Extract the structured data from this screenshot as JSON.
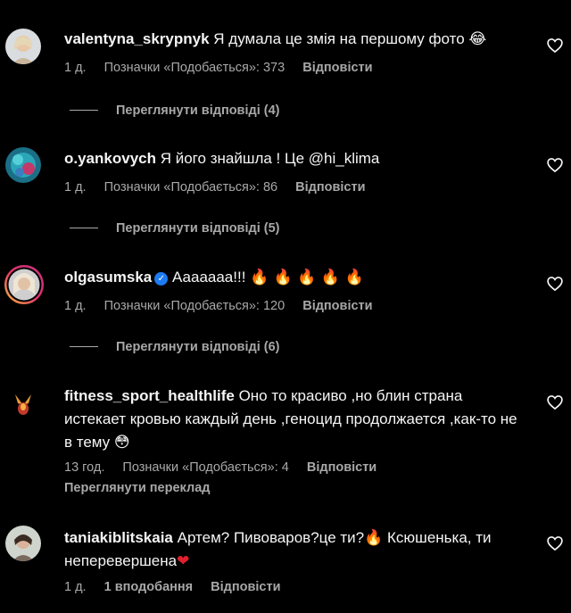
{
  "comments": [
    {
      "username": "valentyna_skrypnyk",
      "text": "Я думала це змія на першому фото",
      "emoji": "😂",
      "time": "1 д.",
      "likes": "Позначки «Подобається»: 373",
      "reply": "Відповісти",
      "view_replies": "Переглянути відповіді (4)"
    },
    {
      "username": "o.yankovych",
      "text": "Я його знайшла ! Це @hi_klima",
      "time": "1 д.",
      "likes": "Позначки «Подобається»: 86",
      "reply": "Відповісти",
      "view_replies": "Переглянути відповіді (5)"
    },
    {
      "username": "olgasumska",
      "verified": "✓",
      "text": "Ааааааа!!!",
      "emoji": "🔥 🔥 🔥 🔥 🔥",
      "time": "1 д.",
      "likes": "Позначки «Подобається»: 120",
      "reply": "Відповісти",
      "view_replies": "Переглянути відповіді (6)"
    },
    {
      "username": "fitness_sport_healthlife",
      "text": "Оно то красиво ,но блин страна истекает кровью каждый день ,геноцид продолжается ,как-то не в тему",
      "emoji": "😳",
      "time": "13 год.",
      "likes": "Позначки «Подобається»: 4",
      "reply": "Відповісти",
      "translate": "Переглянути переклад"
    },
    {
      "username": "taniakiblitskaia",
      "text": "Артем? Пивоваров?це ти?",
      "emoji": "🔥",
      "text2": "Ксюшенька, ти неперевершена",
      "emoji2": "❤",
      "time": "1 д.",
      "likes": "1 вподобання",
      "reply": "Відповісти"
    }
  ],
  "colors": {
    "background": "#000000",
    "text": "#f5f5f5",
    "secondary": "#a8a8a8",
    "verified": "#1d7bf2"
  },
  "icons": {
    "like": "heart-outline-icon",
    "verified": "verified-badge-icon"
  }
}
